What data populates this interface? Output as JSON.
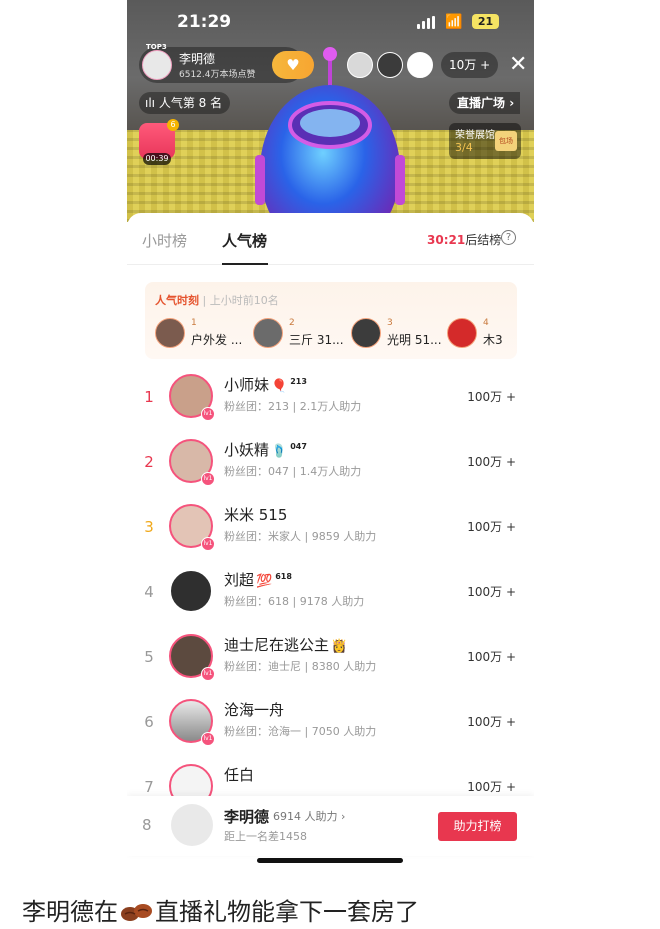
{
  "status_bar": {
    "time": "21:29",
    "battery": "21"
  },
  "live": {
    "anchor_top_badge": "TOP3",
    "anchor_name": "李明德",
    "anchor_likes": "6512.4万本场点赞",
    "viewer_count": "10万 +",
    "rank_chip": "人气第 8 名",
    "plaza_label": "直播广场",
    "gift_count": "6",
    "gift_timer": "00:39",
    "hall_title": "荣誉展馆",
    "hall_progress": "3/4",
    "hall_badge": "包场"
  },
  "tabs": [
    {
      "label": "小时榜"
    },
    {
      "label": "人气榜"
    }
  ],
  "countdown": {
    "time": "30:21",
    "suffix": "后结榜"
  },
  "moment": {
    "title": "人气时刻",
    "subtitle": "上小时前10名",
    "items": [
      {
        "rank": "1",
        "name": "户外发 ..."
      },
      {
        "rank": "2",
        "name": "三斤 31..."
      },
      {
        "rank": "3",
        "name": "光明 51..."
      },
      {
        "rank": "4",
        "name": "木3"
      }
    ]
  },
  "ranking": [
    {
      "rank": "1",
      "name": "小师妹",
      "level": "213",
      "emoji": "🎈",
      "fans": "粉丝团：213",
      "help": "2.1万人助力",
      "value": "100万 +"
    },
    {
      "rank": "2",
      "name": "小妖精",
      "level": "047",
      "emoji": "🩴",
      "fans": "粉丝团：047",
      "help": "1.4万人助力",
      "value": "100万 +"
    },
    {
      "rank": "3",
      "name": "米米 515",
      "level": "",
      "emoji": "",
      "fans": "粉丝团：米家人",
      "help": "9859 人助力",
      "value": "100万 +"
    },
    {
      "rank": "4",
      "name": "刘超",
      "level": "618",
      "emoji": "💯",
      "fans": "粉丝团：618",
      "help": "9178 人助力",
      "value": "100万 +"
    },
    {
      "rank": "5",
      "name": "迪士尼在逃公主",
      "level": "",
      "emoji": "👸",
      "fans": "粉丝团：迪士尼",
      "help": "8380 人助力",
      "value": "100万 +"
    },
    {
      "rank": "6",
      "name": "沧海一舟",
      "level": "",
      "emoji": "",
      "fans": "粉丝团：沧海一",
      "help": "7050 人助力",
      "value": "100万 +"
    },
    {
      "rank": "7",
      "name": "任白",
      "level": "",
      "emoji": "",
      "fans": "",
      "help": "",
      "value": "100万 +"
    }
  ],
  "me": {
    "rank": "8",
    "name": "李明德",
    "help": "6914 人助力 ›",
    "gap": "距上一名差1458",
    "button": "助力打榜"
  },
  "caption": {
    "before": "李明德在",
    "after": "直播礼物能拿下一套房了"
  },
  "colors": {
    "accent": "#e8374f",
    "gold": "#f0a91c",
    "fan_ring": "#f5537c"
  }
}
